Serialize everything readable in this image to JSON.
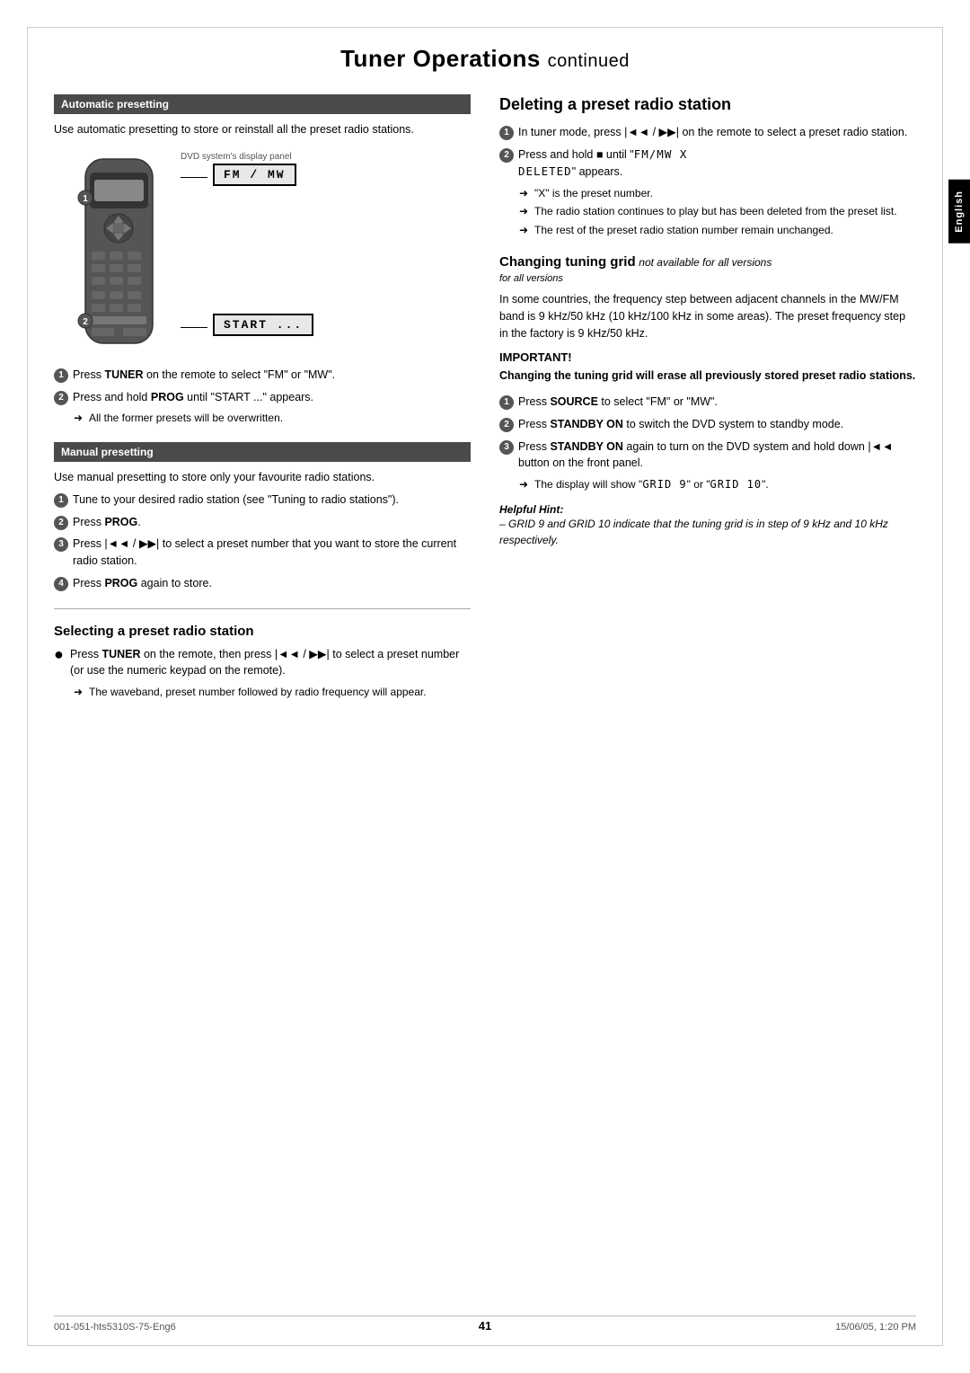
{
  "page": {
    "title": "Tuner Operations",
    "title_continued": "continued",
    "page_number": "41",
    "footer_left": "001-051-hts5310S-75-Eng6",
    "footer_center": "41",
    "footer_right": "15/06/05, 1:20 PM",
    "english_tab": "English"
  },
  "left_column": {
    "auto_presetting": {
      "heading": "Automatic presetting",
      "description": "Use automatic presetting to store or reinstall all the preset radio stations.",
      "display_label": "DVD system's display panel",
      "lcd1": "FM / MW",
      "lcd2": "START ...",
      "step1_num": "1",
      "step1_text": "Press TUNER on the remote to select \"FM\" or \"MW\".",
      "step2_num": "2",
      "step2_text": "Press and hold PROG until \"START ...\" appears.",
      "arrow1": "All the former presets will be overwritten."
    },
    "manual_presetting": {
      "heading": "Manual presetting",
      "description": "Use manual presetting to store only your favourite radio stations.",
      "step1_num": "1",
      "step1_text": "Tune to your desired radio station (see \"Tuning to radio stations\").",
      "step2_num": "2",
      "step2_text": "Press PROG.",
      "step3_num": "3",
      "step3_text": "Press |◄◄ / ►►| to select a preset number that you want to store the current radio station.",
      "step4_num": "4",
      "step4_text": "Press PROG again to store."
    },
    "selecting_preset": {
      "heading": "Selecting a preset radio station",
      "bullet_text1": "Press TUNER on the remote, then press |◄◄ / ►►| to select a preset number (or use the numeric keypad on the remote).",
      "arrow1": "The waveband, preset number followed by radio frequency will appear."
    }
  },
  "right_column": {
    "deleting_preset": {
      "heading": "Deleting a preset radio station",
      "step1_num": "1",
      "step1_text": "In tuner mode, press |◄◄ / ►►| on the remote to select a preset radio station.",
      "step2_num": "2",
      "step2_text": "Press and hold ■ until \"FM/MW X DELETED\" appears.",
      "arrow1": "\"X\" is the preset number.",
      "arrow2": "The radio station continues to play but has been deleted from the preset list.",
      "arrow3": "The rest of the preset radio station number remain unchanged."
    },
    "changing_tuning_grid": {
      "heading": "Changing tuning grid",
      "subheading": "not available for all versions",
      "description": "In some countries, the frequency step between adjacent channels in the MW/FM band is 9 kHz/50 kHz (10 kHz/100 kHz in some areas). The preset frequency step in the factory is 9 kHz/50 kHz.",
      "important_label": "IMPORTANT!",
      "important_text": "Changing the tuning grid will erase all previously stored preset radio stations.",
      "step1_num": "1",
      "step1_text": "Press SOURCE to select \"FM\" or \"MW\".",
      "step2_num": "2",
      "step2_text": "Press STANDBY ON to switch the DVD system to standby mode.",
      "step3_num": "3",
      "step3_text": "Press STANDBY ON again to turn on the DVD system and hold down |◄◄ button on the front panel.",
      "arrow1": "The display will show \"GRID 9\" or \"GRID 10\".",
      "helpful_hint_title": "Helpful Hint:",
      "helpful_hint_text": "– GRID 9 and GRID 10 indicate that the tuning grid is in step of 9 kHz and 10 kHz respectively."
    }
  }
}
